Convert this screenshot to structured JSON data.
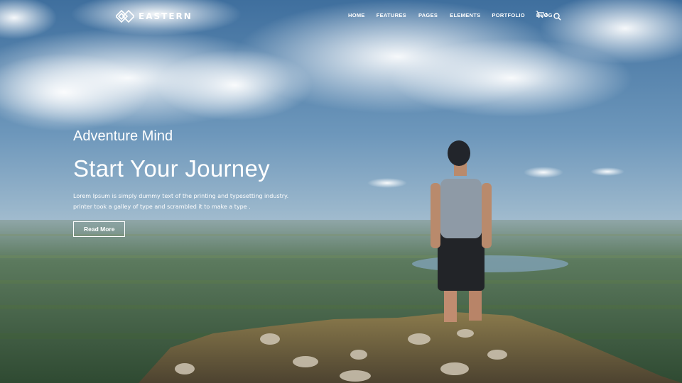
{
  "brand": {
    "name": "EASTERN"
  },
  "nav": {
    "items": [
      {
        "label": "HOME"
      },
      {
        "label": "FEATURES"
      },
      {
        "label": "PAGES"
      },
      {
        "label": "ELEMENTS"
      },
      {
        "label": "PORTFOLIO"
      },
      {
        "label": "BLOG"
      }
    ],
    "cart_count": "2"
  },
  "hero": {
    "subtitle": "Adventure Mind",
    "title": "Start Your Journey",
    "description_line1": "Lorem Ipsum is simply dummy text of the printing and typesetting industry.",
    "description_line2": "printer took a galley of type and scrambled it to make a type .",
    "button_label": "Read More"
  },
  "icons": {
    "logo": "diamond-logo-icon",
    "cart": "shopping-cart-icon",
    "search": "search-icon"
  },
  "colors": {
    "sky": "#5e8fb8",
    "haze": "#a9c0cf",
    "land": "#4b6a48",
    "rock": "#8a7e5c",
    "text": "#ffffff"
  }
}
